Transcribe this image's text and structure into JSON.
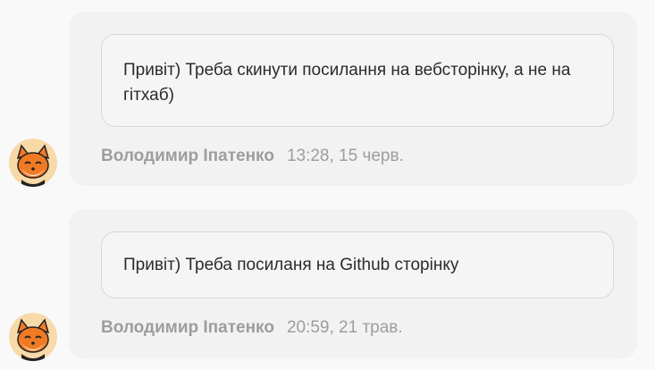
{
  "comments": [
    {
      "text": "Привіт) Треба скинути посилання на вебсторінку, а не на гітхаб)",
      "author": "Володимир Іпатенко",
      "time": "13:28, 15 черв.",
      "avatar_icon": "fox-avatar-icon"
    },
    {
      "text": "Привіт) Треба посиланя на Github сторінку",
      "author": "Володимир Іпатенко",
      "time": "20:59, 21 трав.",
      "avatar_icon": "fox-avatar-icon"
    }
  ],
  "colors": {
    "page_bg": "#f9f9f9",
    "card_bg": "#f2f2f2",
    "bubble_border": "#d8d8d8",
    "meta_text": "#9d9d9d",
    "avatar_bg": "#f8d9a8",
    "fox_orange": "#f07a24"
  }
}
